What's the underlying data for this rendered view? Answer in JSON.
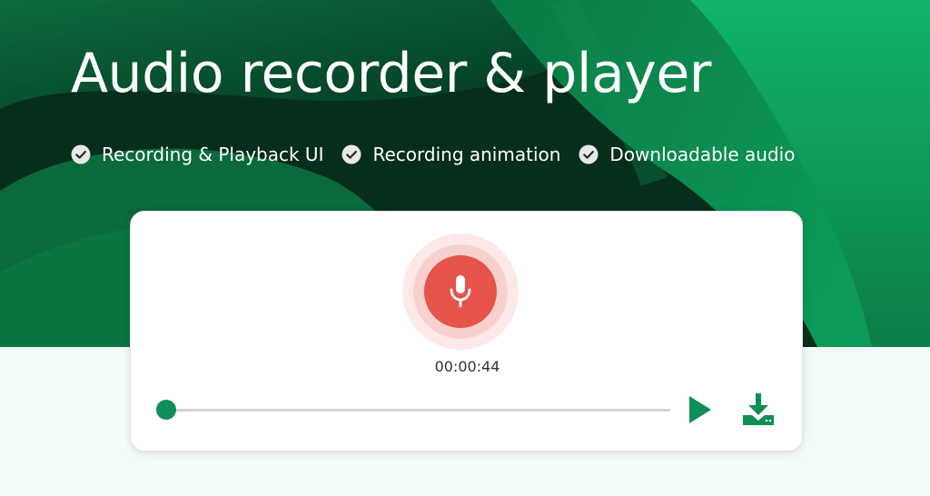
{
  "header": {
    "title": "Audio recorder & player"
  },
  "features": [
    {
      "label": "Recording & Playback UI",
      "icon": "check-circle-icon"
    },
    {
      "label": "Recording animation",
      "icon": "check-circle-icon"
    },
    {
      "label": "Downloadable audio",
      "icon": "check-circle-icon"
    }
  ],
  "player": {
    "record_icon": "microphone-icon",
    "timer": "00:00:44",
    "progress": 0,
    "play_icon": "play-icon",
    "download_icon": "download-icon"
  },
  "colors": {
    "brand_green": "#0e8f55",
    "hero_dark": "#063d26",
    "record_red": "#e5534b",
    "page_bg": "#f3fcf8"
  }
}
